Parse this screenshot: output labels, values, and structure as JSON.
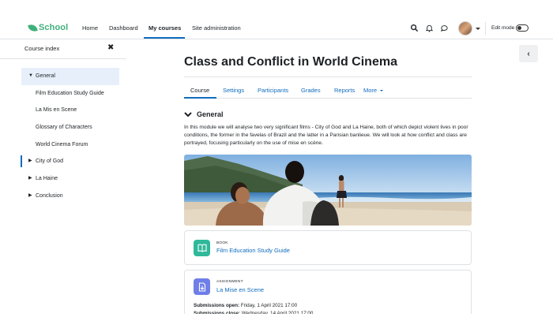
{
  "navbar": {
    "logo_text": "School",
    "links": [
      "Home",
      "Dashboard",
      "My courses",
      "Site administration"
    ],
    "active_link": "My courses",
    "edit_mode_label": "Edit mode",
    "icons": [
      "search-icon",
      "bell-icon",
      "chat-icon"
    ]
  },
  "sidebar": {
    "header": "Course index",
    "close_icon": "✖",
    "items": [
      {
        "label": "General",
        "type": "section",
        "expanded": true,
        "highlight": true
      },
      {
        "label": "Film Education Study Guide",
        "type": "activity"
      },
      {
        "label": "La Mis en Scene",
        "type": "activity"
      },
      {
        "label": "Glossary of Characters",
        "type": "activity"
      },
      {
        "label": "World Cinema Forum",
        "type": "activity"
      },
      {
        "label": "City of God",
        "type": "section",
        "expanded": false,
        "current": true
      },
      {
        "label": "La Haine",
        "type": "section",
        "expanded": false
      },
      {
        "label": "Conclusion",
        "type": "section",
        "expanded": false
      }
    ]
  },
  "course": {
    "title": "Class and Conflict in World Cinema",
    "tabs": [
      "Course",
      "Settings",
      "Participants",
      "Grades",
      "Reports",
      "More"
    ],
    "active_tab": "Course",
    "section_title": "General",
    "summary": "In this module we will analyse two very significant films - City of God and La Haine, both of which depict violent lives in poor conditions, the former in the favelas of Brazil and the latter in a Parisian banlieue. We will look at how conflict and class are portrayed, focusing particularly on the use of mise en scène."
  },
  "activities": [
    {
      "type": "BOOK",
      "name": "Film Education Study Guide",
      "icon": "book-icon",
      "color": "#2fb89a"
    },
    {
      "type": "ASSIGNMENT",
      "name": "La Mise en Scene",
      "icon": "assignment-icon",
      "color": "#6f7fe8",
      "dates": [
        {
          "label": "Submissions open:",
          "value": "Friday, 1 April 2021 17:00"
        },
        {
          "label": "Submissions close:",
          "value": "Wednesday, 14 April 2021 17:00"
        }
      ]
    }
  ],
  "colors": {
    "accent": "#0f6cbf",
    "brand": "#3fb07a",
    "highlight": "#e7f0fa"
  }
}
